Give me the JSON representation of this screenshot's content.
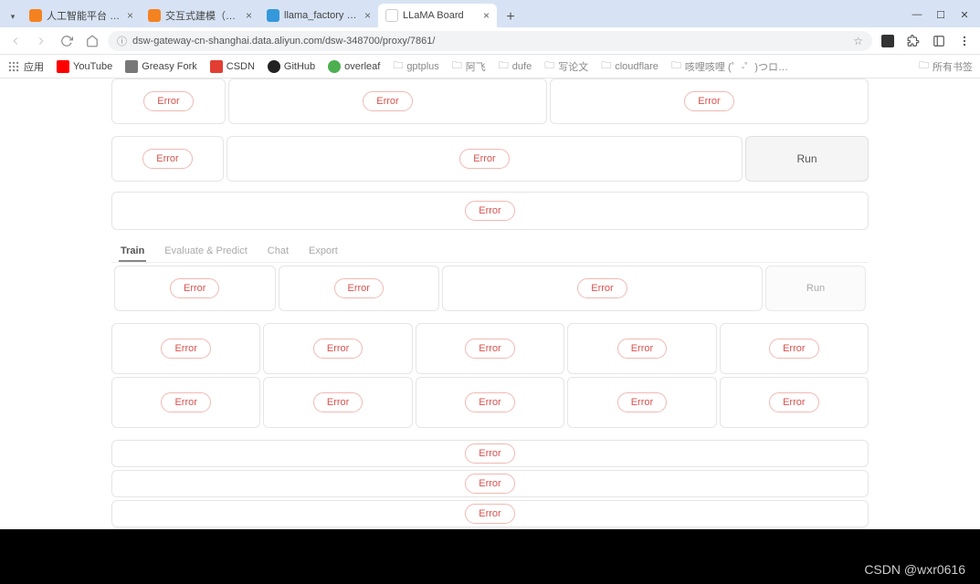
{
  "browser": {
    "tabs": [
      {
        "title": "人工智能平台 PAI_机器学习…",
        "favicon": "fv-orange"
      },
      {
        "title": "交互式建模（DSW）",
        "favicon": "fv-orange"
      },
      {
        "title": "llama_factory · DSW",
        "favicon": "fv-blue"
      },
      {
        "title": "LLaMA Board",
        "favicon": "fv-llama",
        "active": true
      }
    ],
    "url": "dsw-gateway-cn-shanghai.data.aliyun.com/dsw-348700/proxy/7861/",
    "bookmarks": [
      {
        "label": "应用",
        "icon": "apps"
      },
      {
        "label": "YouTube",
        "icon": "fv-yt"
      },
      {
        "label": "Greasy Fork",
        "icon": "fv-gf"
      },
      {
        "label": "CSDN",
        "icon": "fv-csdn"
      },
      {
        "label": "GitHub",
        "icon": "fv-gh"
      },
      {
        "label": "overleaf",
        "icon": "fv-ol"
      },
      {
        "label": "gptplus",
        "icon": "folder"
      },
      {
        "label": "阿飞",
        "icon": "folder"
      },
      {
        "label": "dufe",
        "icon": "folder"
      },
      {
        "label": "写论文",
        "icon": "folder"
      },
      {
        "label": "cloudflare",
        "icon": "folder"
      },
      {
        "label": "咳哩咳哩 (゜-゜)つロ…",
        "icon": "folder"
      }
    ],
    "bookmarks_right": {
      "label": "所有书签",
      "icon": "folder"
    }
  },
  "page": {
    "error_label": "Error",
    "run_big": "Run",
    "run_small": "Run",
    "ui_tabs": [
      {
        "label": "Train",
        "active": true
      },
      {
        "label": "Evaluate & Predict"
      },
      {
        "label": "Chat"
      },
      {
        "label": "Export"
      }
    ]
  },
  "watermark": "CSDN @wxr0616"
}
